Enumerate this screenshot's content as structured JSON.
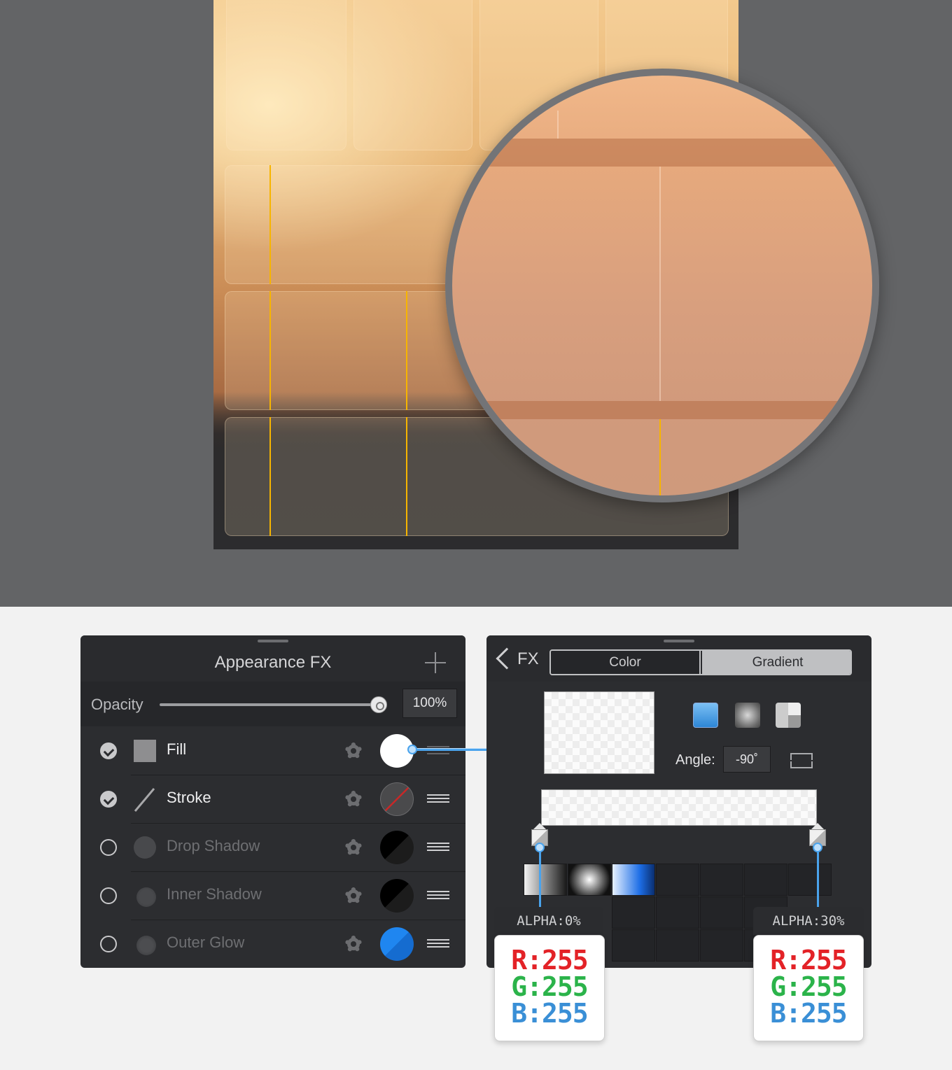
{
  "appearance_panel": {
    "title": "Appearance FX",
    "opacity_label": "Opacity",
    "opacity_value": "100%",
    "opacity_level": 1.0,
    "rows": [
      {
        "label": "Fill",
        "enabled": true,
        "swatch_color": "#ffffff"
      },
      {
        "label": "Stroke",
        "enabled": true,
        "swatch_color": "#4a4a4c"
      },
      {
        "label": "Drop Shadow",
        "enabled": false,
        "swatch_color": "#000000"
      },
      {
        "label": "Inner Shadow",
        "enabled": false,
        "swatch_color": "#000000"
      },
      {
        "label": "Outer Glow",
        "enabled": false,
        "swatch_color": "#1a7de8"
      }
    ]
  },
  "fx_panel": {
    "back_label": "FX",
    "tabs": [
      "Color",
      "Gradient"
    ],
    "selected_tab": "Gradient",
    "angle_label": "Angle:",
    "angle_value": "-90˚",
    "gradient_types": [
      "linear-gradient-icon",
      "radial-gradient-icon",
      "angle-gradient-icon"
    ]
  },
  "stops": [
    {
      "alpha_label": "ALPHA:0%",
      "r": "R:255",
      "g": "G:255",
      "b": "B:255"
    },
    {
      "alpha_label": "ALPHA:30%",
      "r": "R:255",
      "g": "G:255",
      "b": "B:255"
    }
  ],
  "colors": {
    "guide": "#f7b500",
    "accent": "#4aa3ec",
    "panel_bg": "#2c2d30",
    "canvas_bg": "#636466"
  }
}
